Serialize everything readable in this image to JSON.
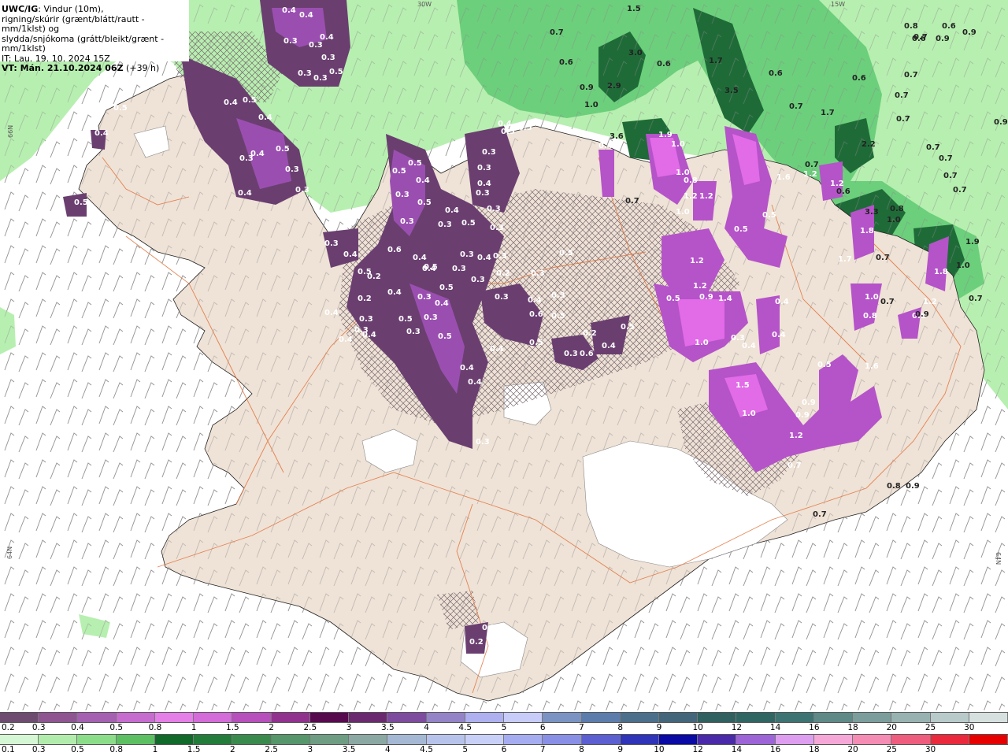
{
  "header": {
    "line1_bold": "UWC/IG",
    "line1_rest": ": Vindur (10m),",
    "line2": "rigning/skúrir (grænt/blátt/rautt - mm/1klst) og",
    "line3": "slydda/snjókoma (grátt/bleikt/grænt - mm/1klst)",
    "line4": "IT: Lau. 19. 10. 2024 15Z",
    "line5_bold": "VT: Mán. 21.10.2024 06Z",
    "line5_rest": " (+39 h)"
  },
  "coords": {
    "top_left": "30W",
    "top_right": "15W",
    "left_upper": "66N",
    "left_lower": "64N",
    "right_lower": "64N",
    "left_mid": "66N"
  },
  "colors": {
    "sea": "#ffffff",
    "land": "#efe2d6",
    "glacier": "#ffffff",
    "roads": "#e0723c",
    "light_green": "#b7efb0",
    "mid_green": "#6ccf7c",
    "dark_green": "#1f6b38",
    "purple_dark": "#6a3f70",
    "purple_mid": "#9a4fb0",
    "magenta": "#e26be8"
  },
  "labels": {
    "purple": [
      "0.4",
      "0.4",
      "0.3",
      "0.3",
      "0.3",
      "0.3",
      "0.4",
      "0.3",
      "0.5",
      "0.4",
      "0.5",
      "0.4",
      "0.5",
      "0.4",
      "0.3",
      "0.3",
      "0.4",
      "0.3",
      "0.5",
      "0.5",
      "0.4",
      "0.3",
      "0.5",
      "0.4",
      "0.3",
      "0.6",
      "0.4",
      "0.3",
      "0.5",
      "0.3",
      "0.3",
      "0.3",
      "0.4",
      "0.3",
      "0.3",
      "0.5",
      "0.5",
      "0.3",
      "0.3",
      "0.5",
      "0.5",
      "0.4",
      "0.3",
      "0.3",
      "0.4",
      "0.5",
      "0.3",
      "0.3",
      "0.5",
      "0.4",
      "0.4",
      "0.3",
      "0.2",
      "0.3",
      "0.4",
      "0.4",
      "0.4",
      "0.2",
      "0.4",
      "0.4",
      "0.3",
      "0.3",
      "0.4",
      "0.6",
      "0.5",
      "0.5",
      "0.4",
      "0.3",
      "0.6",
      "0.5",
      "0.2",
      "0.3",
      "0.5",
      "0.5",
      "0.4",
      "0.5",
      "0.3",
      "0.4",
      "0.3",
      "0.3",
      "0.4",
      "0.4",
      "0.4",
      "0.2",
      "0.3",
      "0.2",
      "0.3",
      "0.5",
      "0.4"
    ],
    "magenta": [
      "1.9",
      "1.0",
      "1.0",
      "1.2",
      "1.0",
      "0.8",
      "1.2",
      "1.6",
      "1.2",
      "1.2",
      "0.5",
      "0.5",
      "1.2",
      "0.5",
      "1.2",
      "0.9",
      "1.4",
      "1.0",
      "0.3",
      "0.4",
      "0.4",
      "0.4",
      "1.0",
      "0.8",
      "1.6",
      "0.5",
      "1.5",
      "0.9",
      "0.9",
      "1.0",
      "1.2",
      "0.7",
      "1.8",
      "1.7",
      "0.8",
      "1.2",
      "1.8"
    ],
    "green": [
      "0.7",
      "0.6",
      "0.9",
      "1.0",
      "2.9",
      "3.0",
      "0.6",
      "1.5",
      "3.6",
      "1.7",
      "3.5",
      "0.6",
      "0.7",
      "1.7",
      "0.6",
      "0.7",
      "0.7",
      "0.7",
      "0.9",
      "0.6",
      "0.8",
      "0.9",
      "0.6",
      "0.9",
      "0.7",
      "0.7",
      "0.7",
      "0.7",
      "2.2",
      "0.7",
      "0.7",
      "0.6",
      "3.3",
      "0.8",
      "1.0",
      "1.9",
      "1.0",
      "0.7",
      "0.7",
      "0.7",
      "0.9",
      "0.8",
      "0.9",
      "0.7",
      "0.7"
    ]
  },
  "scale_upper": {
    "title": "slydda/snjókoma",
    "ticks": [
      "0.2",
      "0.3",
      "0.4",
      "0.5",
      "0.8",
      "1",
      "1.5",
      "2",
      "2.5",
      "3",
      "3.5",
      "4",
      "4.5",
      "5",
      "6",
      "7",
      "8",
      "9",
      "10",
      "12",
      "14",
      "16",
      "18",
      "20",
      "25",
      "30"
    ],
    "colors": [
      "#6e4c70",
      "#8e5591",
      "#a660b2",
      "#c66ccf",
      "#e47fe8",
      "#d36bd9",
      "#b750bc",
      "#92328f",
      "#580a4f",
      "#6b2a6f",
      "#7e4c9e",
      "#9583c8",
      "#aeb0f0",
      "#c7ccf8",
      "#7a93c3",
      "#5c7cab",
      "#4c6f8c",
      "#44667a",
      "#30605f",
      "#2f6664",
      "#3d7473",
      "#5e8987",
      "#7b9e9c",
      "#98b2b1",
      "#b8cac9",
      "#d6e1df"
    ]
  },
  "scale_lower": {
    "title": "rigning/skúrir",
    "ticks": [
      "0.1",
      "0.3",
      "0.5",
      "0.8",
      "1",
      "1.5",
      "2",
      "2.5",
      "3",
      "3.5",
      "4",
      "4.5",
      "5",
      "6",
      "7",
      "8",
      "9",
      "10",
      "12",
      "14",
      "16",
      "18",
      "20",
      "25",
      "30"
    ],
    "colors": [
      "#d6f7d3",
      "#b2ecac",
      "#8cdd8a",
      "#5cc063",
      "#116a2a",
      "#237c3a",
      "#3a8a4d",
      "#56966a",
      "#6e9d83",
      "#8ca8a3",
      "#a5b8d3",
      "#b8c3ec",
      "#c9d0f8",
      "#a6acf0",
      "#8a8fe6",
      "#5b5fd0",
      "#2f34b8",
      "#0a0aa4",
      "#4a2aa8",
      "#9d64d8",
      "#dd9ef0",
      "#f5a8d8",
      "#f58cb4",
      "#ef5d7e",
      "#ea2a3c",
      "#e60000"
    ]
  }
}
